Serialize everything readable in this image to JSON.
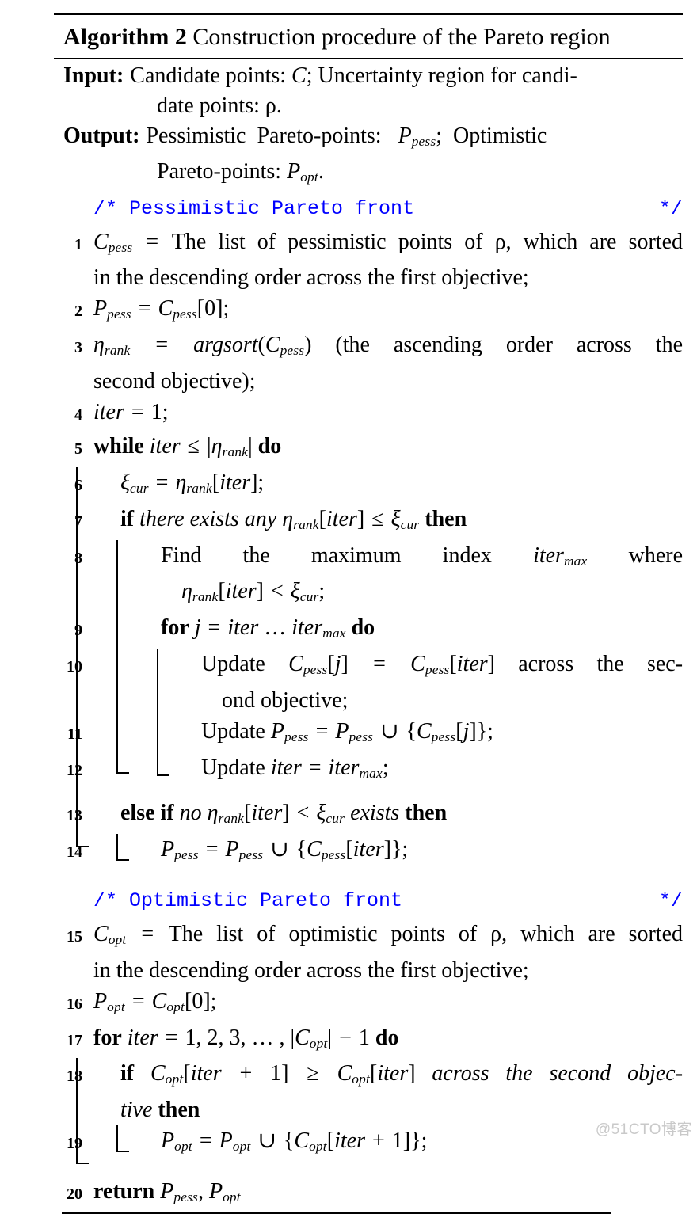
{
  "title": {
    "prefix": "Algorithm 2",
    "text": "Construction procedure of the Pareto region"
  },
  "io": {
    "input_label": "Input:",
    "input_line1": "Candidate points: C; Uncertainty region for candi-",
    "input_line2": "date points: ρ.",
    "output_label": "Output:",
    "output_line1": "Pessimistic  Pareto-points:   P_pess;  Optimistic",
    "output_line2": "Pareto-points: P_opt."
  },
  "comments": {
    "pessimistic_open": "/* Pessimistic Pareto front",
    "pessimistic_close": "*/",
    "optimistic_open": "/* Optimistic Pareto front",
    "optimistic_close": "*/"
  },
  "lines": {
    "n1": "1",
    "l1a": "C_pess = The list of pessimistic points of ρ, which are sorted",
    "l1b": "in the descending order across the first objective;",
    "n2": "2",
    "l2": "P_pess = C_pess[0];",
    "n3": "3",
    "l3a": "η_rank = argsort(C_pess) (the ascending order across the",
    "l3b": "second objective);",
    "n4": "4",
    "l4": "iter = 1;",
    "n5": "5",
    "l5": "while iter ≤ |η_rank| do",
    "n6": "6",
    "l6": "ξ_cur = η_rank[iter];",
    "n7": "7",
    "l7": "if there exists any η_rank[iter] ≤ ξ_cur then",
    "n8": "8",
    "l8a": "Find the maximum index iter_max where",
    "l8b": "η_rank[iter] < ξ_cur;",
    "n9": "9",
    "l9": "for j = iter … iter_max do",
    "n10": "10",
    "l10a": "Update C_pess[j] = C_pess[iter] across the sec-",
    "l10b": "ond objective;",
    "n11": "11",
    "l11": "Update P_pess = P_pess ∪ {C_pess[j]};",
    "n12": "12",
    "l12": "Update iter = iter_max;",
    "n13": "13",
    "l13": "else if no η_rank[iter] < ξ_cur exists then",
    "n14": "14",
    "l14": "P_pess = P_pess ∪ {C_pess[iter]};",
    "n15": "15",
    "l15a": "C_opt = The list of optimistic points of ρ, which are sorted",
    "l15b": "in the descending order across the first objective;",
    "n16": "16",
    "l16": "P_opt = C_opt[0];",
    "n17": "17",
    "l17": "for iter = 1, 2, 3, …, |C_opt| − 1 do",
    "n18": "18",
    "l18a": "if C_opt[iter + 1] ≥ C_opt[iter] across the second objec-",
    "l18b": "tive then",
    "n19": "19",
    "l19": "P_opt = P_opt ∪ {C_opt[iter + 1]};",
    "n20": "20",
    "l20": "return P_pess, P_opt"
  },
  "watermark": "@51CTO博客",
  "colors": {
    "comment": "#0000ff",
    "text": "#000000",
    "watermark": "#c9c9c9"
  }
}
